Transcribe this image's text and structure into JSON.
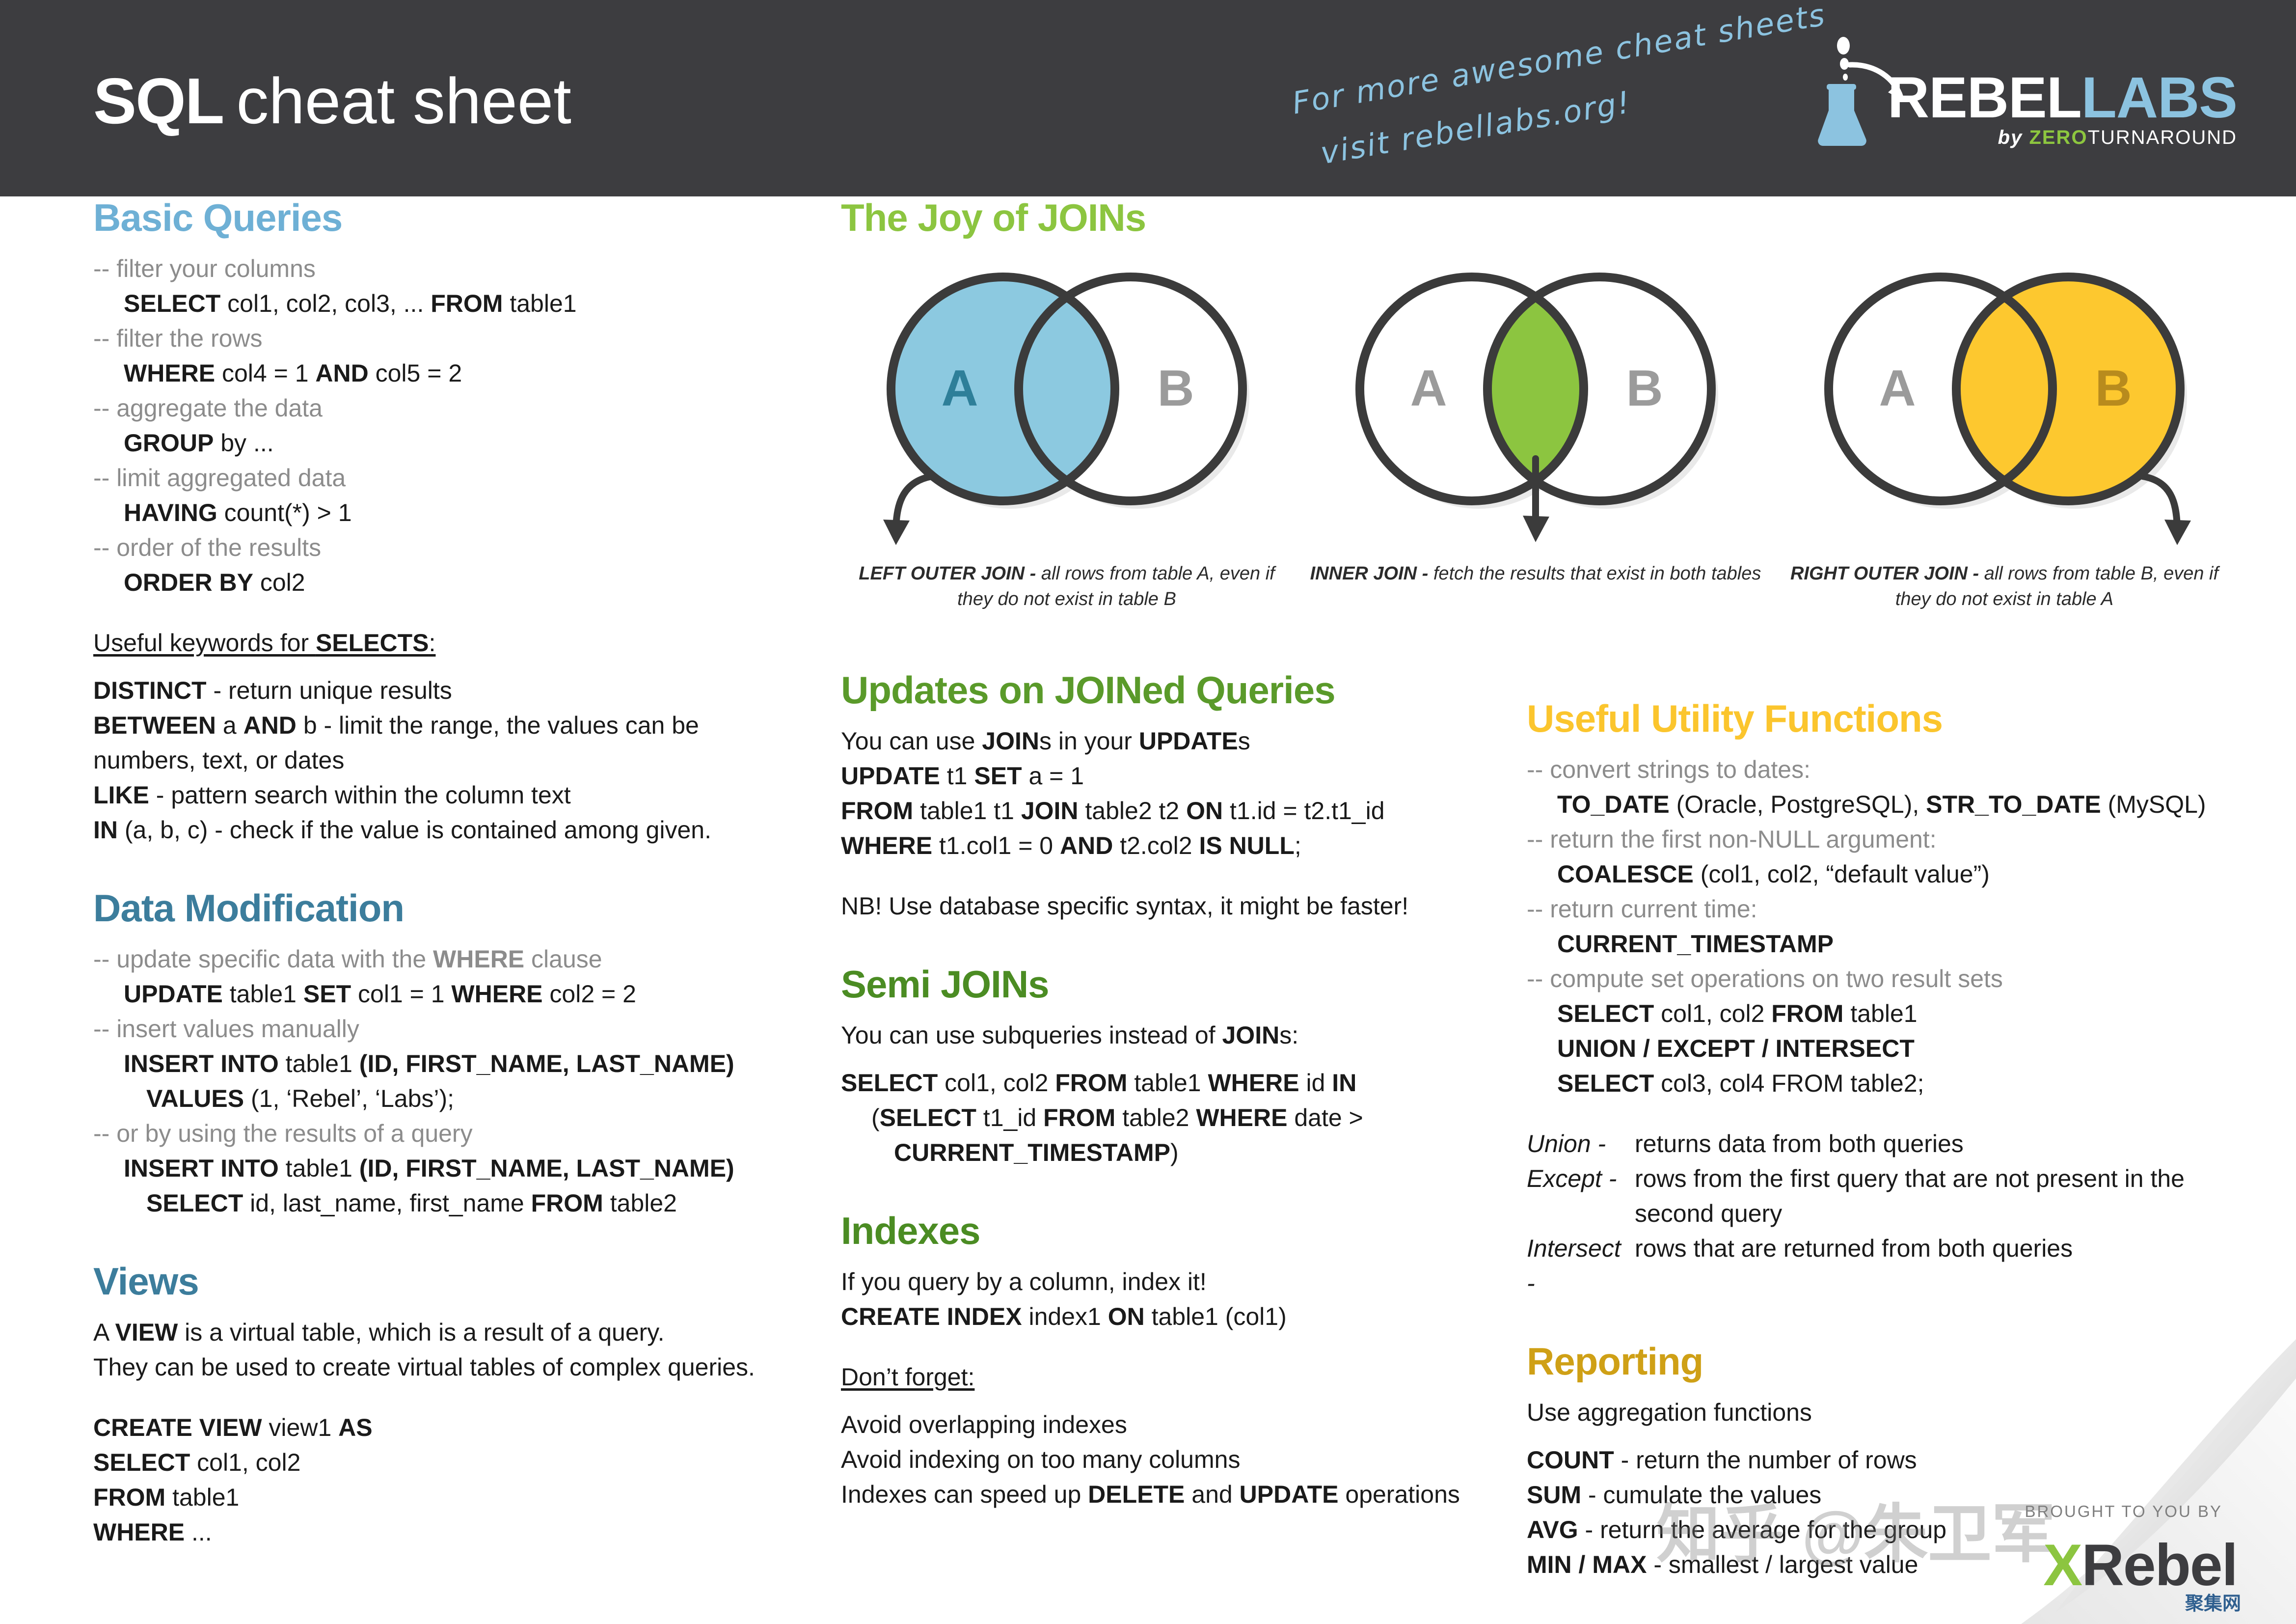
{
  "header": {
    "title_bold": "SQL",
    "title_light": "cheat sheet",
    "promo_line1": "For more awesome cheat sheets",
    "promo_line2": "visit rebellabs.org!",
    "logo": {
      "rebel": "REBEL",
      "labs": "LABS",
      "by": "by ",
      "zero": "ZERO",
      "turnaround": "TURNAROUND"
    },
    "colors": {
      "background": "#3d3d40",
      "accent_blue": "#8cc3e0",
      "accent_green": "#8dc63f"
    }
  },
  "col1": {
    "basic_queries": {
      "heading": "Basic Queries",
      "color": "#6eb0d5",
      "lines": [
        {
          "indent": 0,
          "html": "--  filter your columns",
          "comment": true
        },
        {
          "indent": 1,
          "html": "<b>SELECT</b> col1, col2, col3, ... <b>FROM</b> table1"
        },
        {
          "indent": 0,
          "html": "--  filter the rows",
          "comment": true
        },
        {
          "indent": 1,
          "html": "<b>WHERE</b> col4 = 1 <b>AND</b> col5 = 2"
        },
        {
          "indent": 0,
          "html": "-- aggregate the data",
          "comment": true
        },
        {
          "indent": 1,
          "html": "<b>GROUP</b> by ..."
        },
        {
          "indent": 0,
          "html": "-- limit aggregated data",
          "comment": true
        },
        {
          "indent": 1,
          "html": "<b>HAVING</b> count(*) &gt; 1"
        },
        {
          "indent": 0,
          "html": "-- order of the results",
          "comment": true
        },
        {
          "indent": 1,
          "html": "<b>ORDER BY</b> col2"
        }
      ],
      "keywords_title": "Useful keywords for <b>SELECTS</b>:",
      "keywords": [
        "<b>DISTINCT</b> - return unique results",
        "<b>BETWEEN</b> a <b>AND</b> b - limit the range, the values can be numbers, text, or dates",
        "<b>LIKE</b> - pattern search within the column text",
        "<b>IN</b> (a, b, c) - check if the value is contained among given."
      ]
    },
    "data_modification": {
      "heading": "Data Modification",
      "color": "#3c7d9c",
      "lines": [
        {
          "indent": 0,
          "html": "-- update specific data with the <b>WHERE</b> clause",
          "comment": true
        },
        {
          "indent": 1,
          "html": "<b>UPDATE</b> table1 <b>SET</b> col1 = 1 <b>WHERE</b> col2 = 2"
        },
        {
          "indent": 0,
          "html": "-- insert values manually",
          "comment": true
        },
        {
          "indent": 1,
          "html": "<b>INSERT INTO</b> table1 <b>(ID, FIRST_NAME, LAST_NAME)</b>"
        },
        {
          "indent": 2,
          "html": "<b>VALUES</b> (1, ‘Rebel’, ‘Labs’);"
        },
        {
          "indent": 0,
          "html": "-- or by using the results of a query",
          "comment": true
        },
        {
          "indent": 1,
          "html": "<b>INSERT INTO</b> table1 <b>(ID, FIRST_NAME, LAST_NAME)</b>"
        },
        {
          "indent": 2,
          "html": "<b>SELECT</b> id, last_name, first_name <b>FROM</b> table2"
        }
      ]
    },
    "views": {
      "heading": "Views",
      "color": "#3c7d9c",
      "desc": [
        "A <b>VIEW</b> is a virtual table, which is a result  of a query.",
        "They can be used to create virtual tables of complex queries."
      ],
      "code": [
        "<b>CREATE VIEW</b> view1 <b>AS</b>",
        "<b>SELECT</b> col1, col2",
        "<b>FROM</b> table1",
        "<b>WHERE</b> ..."
      ]
    }
  },
  "col2": {
    "joy_of_joins": {
      "heading": "The Joy of JOINs",
      "color": "#8cc540",
      "diagrams": [
        {
          "name": "left-outer-join",
          "fill": "#8cc9e0",
          "label_a": "A",
          "label_b": "B",
          "a_color": "#2e7f99",
          "b_color": "#9b9b9b",
          "caption_bold": "LEFT OUTER JOIN - ",
          "caption_rest": "all rows from table A, even if they do not exist in table B"
        },
        {
          "name": "inner-join",
          "fill": "#8cc540",
          "label_a": "A",
          "label_b": "B",
          "a_color": "#9b9b9b",
          "b_color": "#9b9b9b",
          "caption_bold": "INNER JOIN - ",
          "caption_rest": "fetch the results that exist in both tables"
        },
        {
          "name": "right-outer-join",
          "fill": "#fdc82f",
          "label_a": "A",
          "label_b": "B",
          "a_color": "#9b9b9b",
          "b_color": "#b88b1d",
          "caption_bold": "RIGHT OUTER JOIN - ",
          "caption_rest": "all rows from table B, even if they do not exist in table A"
        }
      ]
    },
    "updates_on_joined": {
      "heading": "Updates on JOINed Queries",
      "color": "#5a9a2a",
      "lines": [
        "You can use <b>JOIN</b>s in your <b>UPDATE</b>s",
        "<b>UPDATE</b> t1 <b>SET</b> a = 1",
        "<b>FROM</b> table1 t1 <b>JOIN</b> table2 t2 <b>ON</b> t1.id = t2.t1_id",
        "<b>WHERE</b> t1.col1 = 0 <b>AND</b> t2.col2 <b>IS NULL</b>;"
      ],
      "note": "NB! Use database specific syntax, it might be faster!"
    },
    "semi_joins": {
      "heading": "Semi JOINs",
      "color": "#4b8c23",
      "intro": "You can use subqueries instead of <b>JOIN</b>s:",
      "lines": [
        {
          "indent": 0,
          "html": "<b>SELECT</b> col1, col2 <b>FROM</b> table1 <b>WHERE</b> id <b>IN</b>"
        },
        {
          "indent": 1,
          "html": "(<b>SELECT</b> t1_id <b>FROM</b> table2 <b>WHERE</b> date &gt;"
        },
        {
          "indent": 2,
          "html": "<b>CURRENT_TIMESTAMP</b>)"
        }
      ]
    },
    "indexes": {
      "heading": "Indexes",
      "color": "#4b8c23",
      "intro": "If you query by a column, index it!",
      "code": "<b>CREATE INDEX</b> index1 <b>ON</b> table1 (col1)",
      "dont_forget_title": "Don’t forget:",
      "dont_forget": [
        "Avoid overlapping indexes",
        "Avoid indexing on too many columns",
        "Indexes can speed up <b>DELETE</b> and <b>UPDATE</b> operations"
      ]
    }
  },
  "col3": {
    "utility_functions": {
      "heading": "Useful Utility Functions",
      "color": "#fbc52d",
      "lines": [
        {
          "indent": 0,
          "html": "-- convert strings to dates:",
          "comment": true
        },
        {
          "indent": 1,
          "html": "<b>TO_DATE</b> (Oracle, PostgreSQL), <b>STR_TO_DATE</b> (MySQL)"
        },
        {
          "indent": 0,
          "html": "-- return the first non-NULL argument:",
          "comment": true
        },
        {
          "indent": 1,
          "html": "<b>COALESCE</b> (col1, col2, “default value”)"
        },
        {
          "indent": 0,
          "html": "-- return current time:",
          "comment": true
        },
        {
          "indent": 1,
          "html": "<b>CURRENT_TIMESTAMP</b>"
        },
        {
          "indent": 0,
          "html": "-- compute set operations on two result sets",
          "comment": true
        },
        {
          "indent": 1,
          "html": "<b>SELECT</b> col1, col2 <b>FROM</b> table1"
        },
        {
          "indent": 1,
          "html": "<b>UNION / EXCEPT / INTERSECT</b>"
        },
        {
          "indent": 1,
          "html": "<b>SELECT</b> col3, col4 FROM table2;"
        }
      ],
      "definitions": [
        {
          "term": "Union -",
          "body": "returns data from both queries"
        },
        {
          "term": "Except -",
          "body": "rows from the first query that are not present in the second query"
        },
        {
          "term": "Intersect -",
          "body": "rows that are returned from both queries"
        }
      ]
    },
    "reporting": {
      "heading": "Reporting",
      "color": "#cfa016",
      "intro": "Use aggregation functions",
      "items": [
        "<b>COUNT</b> - return the number of rows",
        "<b>SUM</b> - cumulate the values",
        "<b>AVG</b> - return the average for the group",
        "<b>MIN / MAX</b> - smallest / largest value"
      ]
    }
  },
  "footer": {
    "brought_to_you_by": "BROUGHT TO YOU BY",
    "xrebel_x": "X",
    "xrebel_rebel": "Rebel",
    "cn_tag": "聚集网",
    "watermark": "知乎 @朱卫军"
  }
}
